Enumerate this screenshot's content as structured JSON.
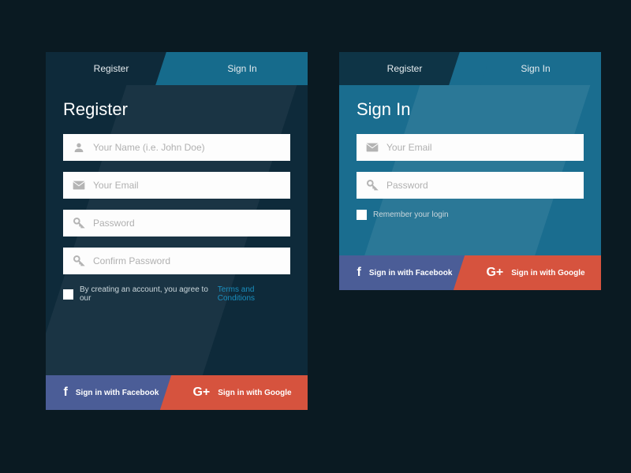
{
  "colors": {
    "bg": "#0a1a22",
    "registerCard": "#0e2a3a",
    "signinCard": "#1a6d8f",
    "tabActive": "#166b8c",
    "facebook": "#4b5d97",
    "google": "#d6533e",
    "link": "#1a8fbf"
  },
  "register": {
    "tabs": {
      "register": "Register",
      "signin": "Sign In"
    },
    "title": "Register",
    "fields": {
      "name": "Your Name (i.e. John Doe)",
      "email": "Your Email",
      "password": "Password",
      "confirm": "Confirm Password"
    },
    "terms_prefix": "By creating an account, you agree to our",
    "terms_link": "Terms and Conditions",
    "social": {
      "facebook": "Sign in with Facebook",
      "google": "Sign in with Google"
    }
  },
  "signin": {
    "tabs": {
      "register": "Register",
      "signin": "Sign In"
    },
    "title": "Sign In",
    "fields": {
      "email": "Your Email",
      "password": "Password"
    },
    "remember": "Remember your login",
    "social": {
      "facebook": "Sign in with Facebook",
      "google": "Sign in with Google"
    }
  }
}
